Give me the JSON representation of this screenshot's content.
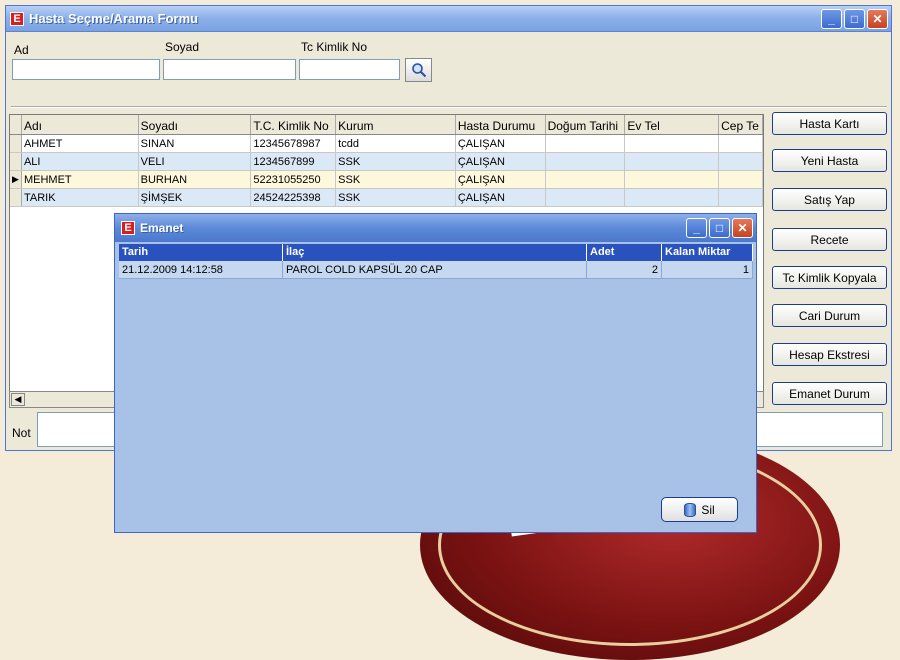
{
  "main_window": {
    "title": "Hasta Seçme/Arama Formu",
    "logo_letter": "E"
  },
  "search": {
    "ad_label": "Ad",
    "soyad_label": "Soyad",
    "tc_label": "Tc Kimlik No",
    "ad_value": "",
    "soyad_value": "",
    "tc_value": ""
  },
  "grid": {
    "columns": [
      "Adı",
      "Soyadı",
      "T.C. Kimlik No",
      "Kurum",
      "Hasta Durumu",
      "Doğum Tarihi",
      "Ev Tel",
      "Cep Te"
    ],
    "rows": [
      [
        "AHMET",
        "SINAN",
        "12345678987",
        "tcdd",
        "ÇALIŞAN",
        "",
        "",
        ""
      ],
      [
        "ALI",
        "VELI",
        "1234567899",
        "SSK",
        "ÇALIŞAN",
        "",
        "",
        ""
      ],
      [
        "MEHMET",
        "BURHAN",
        "52231055250",
        "SSK",
        "ÇALIŞAN",
        "",
        "",
        ""
      ],
      [
        "TARIK",
        "ŞİMŞEK",
        "24524225398",
        "SSK",
        "ÇALIŞAN",
        "",
        "",
        ""
      ]
    ],
    "selected_row": 2,
    "selected_marker": "▶"
  },
  "not_label": "Not",
  "buttons": [
    "Hasta Kartı",
    "Yeni Hasta",
    "Satış Yap",
    "Recete",
    "Tc Kimlik Kopyala",
    "Cari Durum",
    "Hesap Ekstresi",
    "Emanet Durum"
  ],
  "emanet": {
    "title": "Emanet",
    "logo_letter": "E",
    "columns": [
      "Tarih",
      "İlaç",
      "Adet",
      "Kalan Miktar"
    ],
    "rows": [
      [
        "21.12.2009 14:12:58",
        "PAROL COLD KAPSÜL 20 CAP",
        "2",
        "1"
      ]
    ],
    "delete_label": "Sil"
  },
  "colors": {
    "title_blue": "#7aa2e2",
    "emanet_header": "#2a52be",
    "emanet_bg": "#a7c2e6",
    "row_alt": "#dbe8f6",
    "row_selected": "#fdf7dc"
  }
}
